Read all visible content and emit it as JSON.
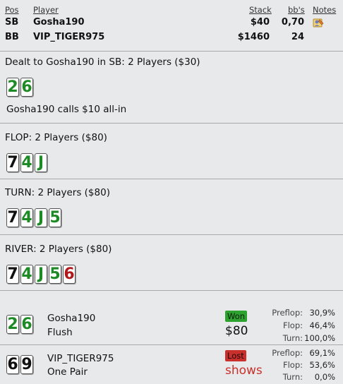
{
  "header": {
    "col_pos": "Pos",
    "col_player": "Player",
    "col_stack": "Stack",
    "col_bbs": "bb's",
    "col_notes": "Notes"
  },
  "players": [
    {
      "pos": "SB",
      "name": "Gosha190",
      "stack": "$40",
      "bbs": "0,70",
      "notes_icon": "notes-icon"
    },
    {
      "pos": "BB",
      "name": "VIP_TIGER975",
      "stack": "$1460",
      "bbs": "24"
    }
  ],
  "preflop": {
    "title": "Dealt to Gosha190 in SB: 2 Players ($30)",
    "cards": [
      {
        "rank": "2",
        "color": "green"
      },
      {
        "rank": "6",
        "color": "green"
      }
    ],
    "action": "Gosha190 calls $10 all-in"
  },
  "flop": {
    "title": "FLOP: 2 Players ($80)",
    "cards": [
      {
        "rank": "7",
        "color": "black"
      },
      {
        "rank": "4",
        "color": "green"
      },
      {
        "rank": "J",
        "color": "green"
      }
    ]
  },
  "turn": {
    "title": "TURN: 2 Players ($80)",
    "cards": [
      {
        "rank": "7",
        "color": "black"
      },
      {
        "rank": "4",
        "color": "green"
      },
      {
        "rank": "J",
        "color": "green"
      },
      {
        "rank": "5",
        "color": "green"
      }
    ]
  },
  "river": {
    "title": "RIVER: 2 Players ($80)",
    "cards": [
      {
        "rank": "7",
        "color": "black"
      },
      {
        "rank": "4",
        "color": "green"
      },
      {
        "rank": "J",
        "color": "green"
      },
      {
        "rank": "5",
        "color": "green"
      },
      {
        "rank": "6",
        "color": "red"
      }
    ]
  },
  "showdown": [
    {
      "name": "Gosha190",
      "hand": "Flush",
      "cards": [
        {
          "rank": "2",
          "color": "green"
        },
        {
          "rank": "6",
          "color": "green"
        }
      ],
      "result_badge": "Won",
      "result_text": "$80",
      "stats": [
        {
          "label": "Preflop:",
          "value": "30,9%"
        },
        {
          "label": "Flop:",
          "value": "46,4%"
        },
        {
          "label": "Turn:",
          "value": "100,0%"
        }
      ]
    },
    {
      "name": "VIP_TIGER975",
      "hand": "One Pair",
      "cards": [
        {
          "rank": "6",
          "color": "black"
        },
        {
          "rank": "9",
          "color": "black"
        }
      ],
      "result_badge": "Lost",
      "result_text": "shows",
      "stats": [
        {
          "label": "Preflop:",
          "value": "69,1%"
        },
        {
          "label": "Flop:",
          "value": "53,6%"
        },
        {
          "label": "Turn:",
          "value": "0,0%"
        }
      ]
    }
  ],
  "colors": {
    "background": "#e8e9eb",
    "card_green": "#1e8a25",
    "card_red": "#b0191b",
    "won_badge": "#2ea22e",
    "lost_badge": "#c9302c",
    "lost_text": "#c9302c"
  }
}
